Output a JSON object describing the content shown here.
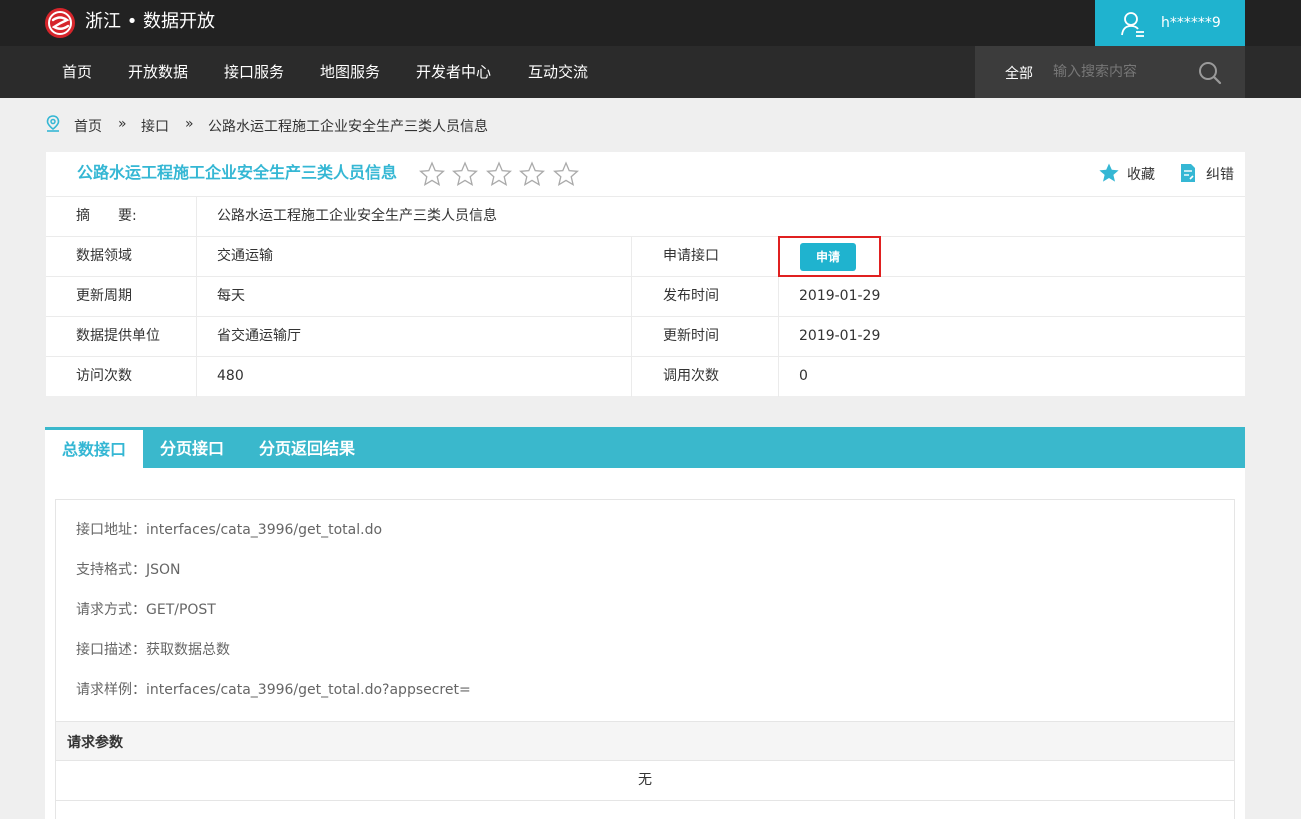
{
  "header": {
    "site_title": "浙江 • 数据开放",
    "user_name": "h******9",
    "logo_icon": "zhejiang-logo-icon",
    "user_icon": "user-icon"
  },
  "nav": {
    "items": [
      "首页",
      "开放数据",
      "接口服务",
      "地图服务",
      "开发者中心",
      "互动交流"
    ],
    "search_scope": "全部",
    "search_placeholder": "输入搜索内容",
    "search_value": ""
  },
  "breadcrumb": {
    "items": [
      "首页",
      "»",
      "接口",
      "»",
      "公路水运工程施工企业安全生产三类人员信息"
    ]
  },
  "card": {
    "title": "公路水运工程施工企业安全生产三类人员信息",
    "rating": 0,
    "rating_max": 5,
    "favorite_label": "收藏",
    "report_error_label": "纠错",
    "summary_label": "摘　　要:",
    "summary_value": "公路水运工程施工企业安全生产三类人员信息",
    "rows": [
      {
        "l1": "数据领域",
        "v1": "交通运输",
        "l2": "申请接口",
        "v2": ""
      },
      {
        "l1": "更新周期",
        "v1": "每天",
        "l2": "发布时间",
        "v2": "2019-01-29"
      },
      {
        "l1": "数据提供单位",
        "v1": "省交通运输厅",
        "l2": "更新时间",
        "v2": "2019-01-29"
      },
      {
        "l1": "访问次数",
        "v1": "480",
        "l2": "调用次数",
        "v2": "0"
      }
    ],
    "apply_button": "申请"
  },
  "tabs": {
    "items": [
      "总数接口",
      "分页接口",
      "分页返回结果"
    ],
    "active_index": 0
  },
  "panel": {
    "details": [
      "接口地址：interfaces/cata_3996/get_total.do",
      "支持格式：JSON",
      "请求方式：GET/POST",
      "接口描述：获取数据总数",
      "请求样例：interfaces/cata_3996/get_total.do?appsecret="
    ],
    "params_header": "请求参数",
    "params_value": "无"
  },
  "colors": {
    "accent": "#1fb3cf",
    "tab_bar": "#3ab8cc",
    "title": "#35b7d4",
    "topbar": "#222222",
    "navbar": "#2b2b2b",
    "highlight_border": "#e02020"
  }
}
